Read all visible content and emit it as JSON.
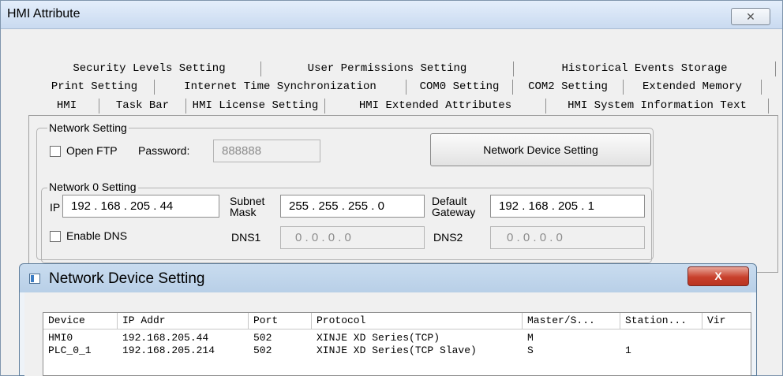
{
  "main_window": {
    "title": "HMI Attribute",
    "close_glyph": "✕"
  },
  "tabs": {
    "row1": [
      "Security Levels Setting",
      "User Permissions Setting",
      "Historical Events Storage"
    ],
    "row2": [
      "Print Setting",
      "Internet Time Synchronization",
      "COM0 Setting",
      "COM2 Setting",
      "Extended Memory"
    ],
    "row3": [
      "HMI",
      "Task Bar",
      "HMI License Setting",
      "HMI Extended Attributes",
      "HMI System Information Text"
    ],
    "active": "HMI"
  },
  "network_setting": {
    "group_label": "Network Setting",
    "open_ftp_label": "Open FTP",
    "password_label": "Password:",
    "password_value": "888888",
    "device_button": "Network Device Setting"
  },
  "network0": {
    "group_label": "Network 0 Setting",
    "ip_label": "IP",
    "ip_value": "192 . 168 . 205 .  44",
    "subnet_label_1": "Subnet",
    "subnet_label_2": "Mask",
    "subnet_value": "255 . 255 . 255 .  0",
    "gateway_label_1": "Default",
    "gateway_label_2": "Gateway",
    "gateway_value": "192 . 168 . 205 .  1",
    "enable_dns_label": "Enable DNS",
    "dns1_label": "DNS1",
    "dns1_value": "0  .  0  .  0  .  0",
    "dns2_label": "DNS2",
    "dns2_value": "0  .  0  .  0  .  0"
  },
  "device_dialog": {
    "title": "Network Device Setting",
    "close_glyph": "X",
    "columns": [
      "Device",
      "IP Addr",
      "Port",
      "Protocol",
      "Master/S...",
      "Station...",
      "Vir"
    ],
    "rows": [
      [
        "HMI0",
        "192.168.205.44",
        "502",
        "XINJE XD Series(TCP)",
        "M",
        "",
        ""
      ],
      [
        "PLC_0_1",
        "192.168.205.214",
        "502",
        "XINJE XD Series(TCP Slave)",
        "S",
        "1",
        ""
      ]
    ]
  }
}
